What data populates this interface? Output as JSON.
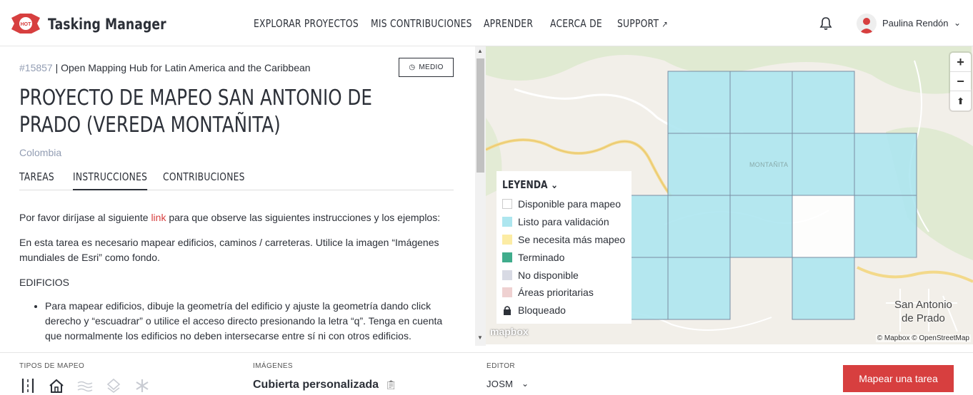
{
  "header": {
    "brand": "Tasking Manager",
    "logo_text": "HOT",
    "nav": [
      {
        "label": "EXPLORAR PROYECTOS"
      },
      {
        "label": "MIS CONTRIBUCIONES"
      },
      {
        "label": "APRENDER"
      },
      {
        "label": "ACERCA DE"
      },
      {
        "label": "SUPPORT"
      }
    ],
    "user_name": "Paulina Rendón"
  },
  "project": {
    "id": "#15857",
    "organization": "| Open Mapping Hub for Latin America and the Caribbean",
    "difficulty": "MEDIO",
    "title": "PROYECTO DE MAPEO SAN ANTONIO DE PRADO (VEREDA MONTAÑITA)",
    "country": "Colombia",
    "tabs": [
      {
        "label": "TAREAS"
      },
      {
        "label": "INSTRUCCIONES"
      },
      {
        "label": "CONTRIBUCIONES"
      }
    ],
    "instructions": {
      "p1_before": "Por favor diríjase al siguiente ",
      "p1_link": "link",
      "p1_after": " para que observe las siguientes instrucciones y los ejemplos:",
      "p2": "En esta tarea es necesario mapear edificios, caminos / carreteras. Utilice la imagen “Imágenes mundiales de Esri” como fondo.",
      "p3": "EDIFICIOS",
      "bullet1": "Para mapear edificios, dibuje la geometría del edificio y ajuste la geometría dando click derecho y “escuadrar” o utilice el acceso directo presionando la letra “q”. Tenga en cuenta que normalmente los edificios no deben intersecarse entre sí ni con otros edificios."
    }
  },
  "map": {
    "legend_title": "LEYENDA",
    "legend": [
      {
        "label": "Disponible para mapeo",
        "color": "#ffffff"
      },
      {
        "label": "Listo para validación",
        "color": "#ade6ef"
      },
      {
        "label": "Se necesita más mapeo",
        "color": "#fceca4"
      },
      {
        "label": "Terminado",
        "color": "#40ac8c"
      },
      {
        "label": "No disponible",
        "color": "#d8dae4"
      },
      {
        "label": "Áreas prioritarias",
        "color": "#efd1d1"
      },
      {
        "label": "Bloqueado",
        "color": "lock-icon"
      }
    ],
    "place_label": "MONTAÑITA",
    "town_line1": "San Antonio",
    "town_line2": "de Prado",
    "mapbox": "mapbox",
    "attribution": "© Mapbox © OpenStreetMap"
  },
  "footer": {
    "mapping_types_label": "TIPOS DE MAPEO",
    "imagery_label": "IMÁGENES",
    "imagery_value": "Cubierta personalizada",
    "editor_label": "EDITOR",
    "editor_value": "JOSM",
    "map_button": "Mapear una tarea"
  },
  "colors": {
    "accent": "#d73f3f",
    "text": "#2c3038",
    "muted": "#929db3"
  }
}
